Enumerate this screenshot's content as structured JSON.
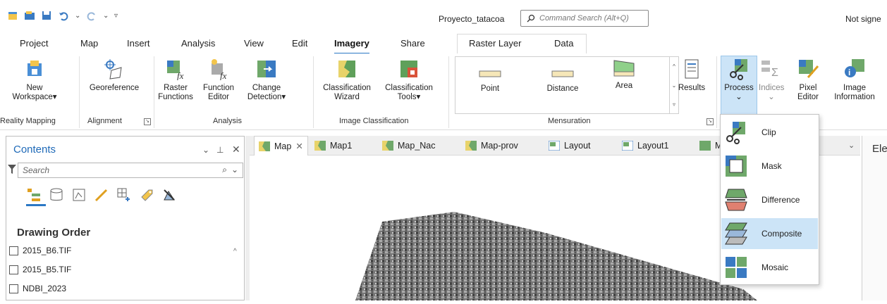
{
  "title_bar": {
    "project_name": "Proyecto_tatacoa",
    "command_search_placeholder": "Command Search (Alt+Q)",
    "sign_in_status": "Not signe"
  },
  "ribbon_tabs": {
    "project": "Project",
    "map": "Map",
    "insert": "Insert",
    "analysis": "Analysis",
    "view": "View",
    "edit": "Edit",
    "imagery": "Imagery",
    "share": "Share",
    "raster_layer": "Raster Layer",
    "data": "Data"
  },
  "ribbon": {
    "new_workspace": "New\nWorkspace",
    "georeference": "Georeference",
    "raster_functions": "Raster\nFunctions",
    "function_editor": "Function\nEditor",
    "change_detection": "Change\nDetection",
    "classification_wizard": "Classification\nWizard",
    "classification_tools": "Classification\nTools",
    "point": "Point",
    "distance": "Distance",
    "area": "Area",
    "results": "Results",
    "process": "Process",
    "indices": "Indices",
    "pixel_editor": "Pixel\nEditor",
    "image_information": "Image\nInformation",
    "groups": {
      "reality_mapping": "Reality Mapping",
      "alignment": "Alignment",
      "analysis": "Analysis",
      "image_classification": "Image Classification",
      "mensuration": "Mensuration"
    }
  },
  "contents": {
    "title": "Contents",
    "search_placeholder": "Search",
    "drawing_order": "Drawing Order",
    "layers": [
      "2015_B6.TIF",
      "2015_B5.TIF",
      "NDBI_2023"
    ]
  },
  "doc_tabs": [
    "Map",
    "Map1",
    "Map_Nac",
    "Map-prov",
    "Layout",
    "Layout1",
    "M"
  ],
  "right_panel_title": "Ele",
  "process_menu": {
    "items": [
      "Clip",
      "Mask",
      "Difference",
      "Composite",
      "Mosaic"
    ],
    "selected": "Composite"
  },
  "colors": {
    "accent": "#2b78c5",
    "selected_bg": "#cce4f7"
  }
}
